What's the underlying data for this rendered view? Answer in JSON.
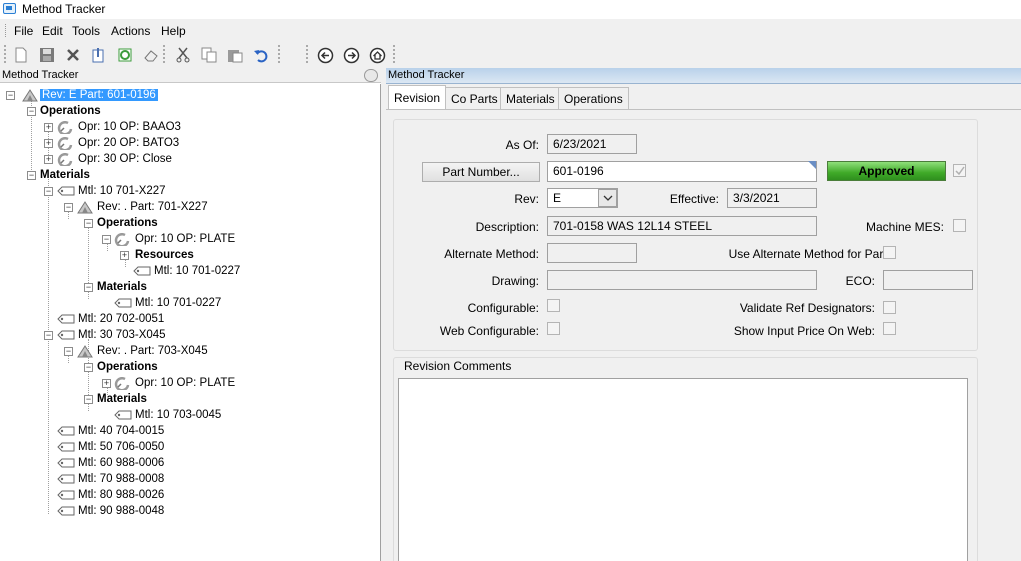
{
  "window": {
    "title": "Method Tracker"
  },
  "menu": [
    "File",
    "Edit",
    "Tools",
    "Actions",
    "Help"
  ],
  "left_panel": {
    "title": "Method Tracker"
  },
  "right_panel": {
    "title": "Method Tracker"
  },
  "tree": [
    {
      "label": "Rev: E Part: 601-0196",
      "icon": "revision-icon",
      "bold": false,
      "selected": true
    },
    {
      "label": "Operations",
      "icon": "",
      "bold": true
    },
    {
      "label": "Opr: 10 OP: BAAO3",
      "icon": "operation-icon"
    },
    {
      "label": "Opr: 20 OP: BATO3",
      "icon": "operation-icon"
    },
    {
      "label": "Opr: 30 OP: Close",
      "icon": "operation-icon"
    },
    {
      "label": "Materials",
      "icon": "",
      "bold": true
    },
    {
      "label": "Mtl: 10 701-X227",
      "icon": "material-icon"
    },
    {
      "label": "Rev: . Part: 701-X227",
      "icon": "revision-icon"
    },
    {
      "label": "Operations",
      "icon": "",
      "bold": true
    },
    {
      "label": "Opr: 10 OP: PLATE",
      "icon": "operation-icon"
    },
    {
      "label": "Resources",
      "icon": "",
      "bold": true
    },
    {
      "label": "Mtl: 10 701-0227",
      "icon": "material-icon"
    },
    {
      "label": "Materials",
      "icon": "",
      "bold": true
    },
    {
      "label": "Mtl: 10 701-0227",
      "icon": "material-icon"
    },
    {
      "label": "Mtl: 20 702-0051",
      "icon": "material-icon"
    },
    {
      "label": "Mtl: 30 703-X045",
      "icon": "material-icon"
    },
    {
      "label": "Rev: . Part: 703-X045",
      "icon": "revision-icon"
    },
    {
      "label": "Operations",
      "icon": "",
      "bold": true
    },
    {
      "label": "Opr: 10 OP: PLATE",
      "icon": "operation-icon"
    },
    {
      "label": "Materials",
      "icon": "",
      "bold": true
    },
    {
      "label": "Mtl: 10 703-0045",
      "icon": "material-icon"
    },
    {
      "label": "Mtl: 40 704-0015",
      "icon": "material-icon"
    },
    {
      "label": "Mtl: 50 706-0050",
      "icon": "material-icon"
    },
    {
      "label": "Mtl: 60 988-0006",
      "icon": "material-icon"
    },
    {
      "label": "Mtl: 70 988-0008",
      "icon": "material-icon"
    },
    {
      "label": "Mtl: 80 988-0026",
      "icon": "material-icon"
    },
    {
      "label": "Mtl: 90 988-0048",
      "icon": "material-icon"
    }
  ],
  "tabs": [
    "Revision",
    "Co Parts",
    "Materials",
    "Operations"
  ],
  "active_tab": "Revision",
  "form": {
    "as_of_label": "As Of:",
    "as_of_value": "6/23/2021",
    "part_number_button": "Part Number...",
    "part_number_value": "601-0196",
    "approved_label": "Approved",
    "rev_label": "Rev:",
    "rev_value": "E",
    "effective_label": "Effective:",
    "effective_value": "3/3/2021",
    "description_label": "Description:",
    "description_value": "701-0158 WAS 12L14 STEEL",
    "machine_mes_label": "Machine MES:",
    "alternate_method_label": "Alternate Method:",
    "alternate_method_value": "",
    "use_alt_method_label": "Use Alternate Method for Parts:",
    "drawing_label": "Drawing:",
    "drawing_value": "",
    "eco_label": "ECO:",
    "eco_value": "",
    "configurable_label": "Configurable:",
    "validate_ref_label": "Validate Ref Designators:",
    "web_configurable_label": "Web Configurable:",
    "show_input_price_label": "Show Input Price On Web:"
  },
  "revision_comments": {
    "label": "Revision Comments",
    "value": ""
  },
  "colors": {
    "selection": "#3399ff",
    "approved_green": "#3faa28",
    "header_blue": "#b9d1ea"
  }
}
